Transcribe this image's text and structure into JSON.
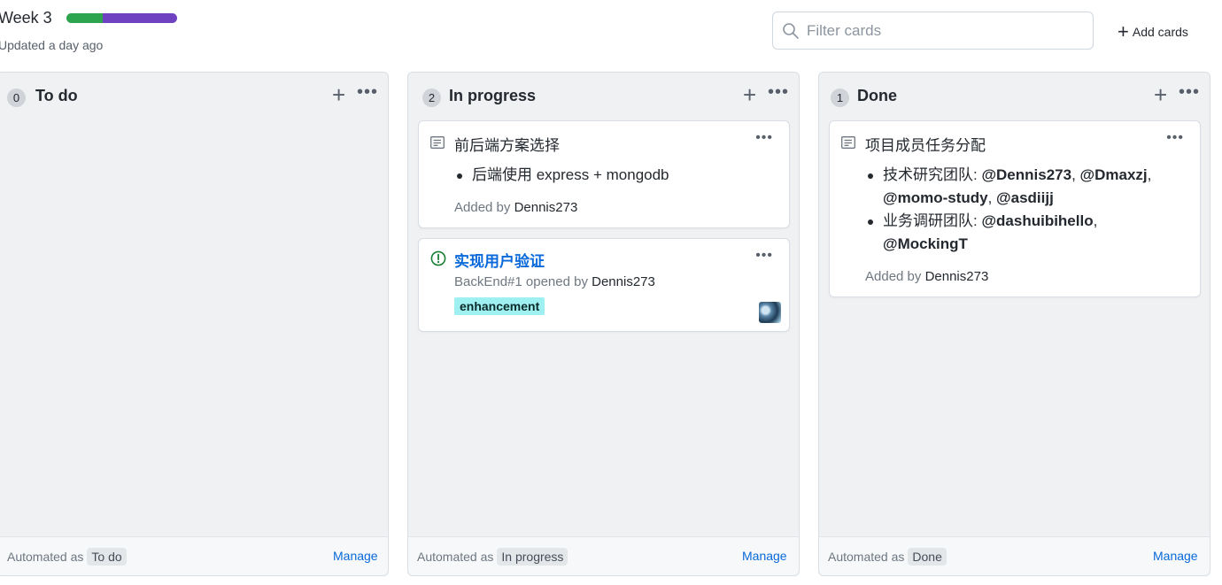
{
  "header": {
    "title": "Week 3",
    "updated": "Updated a day ago",
    "progress": [
      {
        "fraction": 0.33,
        "color": "#2da44e"
      },
      {
        "fraction": 0.67,
        "color": "#6f42c1"
      }
    ],
    "filter_placeholder": "Filter cards",
    "add_cards_label": "Add cards"
  },
  "columns": [
    {
      "count": "0",
      "name": "To do",
      "automated_prefix": "Automated as",
      "automated_tag": "To do",
      "manage_label": "Manage"
    },
    {
      "count": "2",
      "name": "In progress",
      "automated_prefix": "Automated as",
      "automated_tag": "In progress",
      "manage_label": "Manage",
      "cards": [
        {
          "type": "note",
          "title": "前后端方案选择",
          "items": [
            "后端使用 express + mongodb"
          ],
          "added_prefix": "Added by",
          "added_by": "Dennis273"
        },
        {
          "type": "issue",
          "title": "实现用户验证",
          "meta_prefix": "BackEnd#1 opened by",
          "meta_user": "Dennis273",
          "label": "enhancement"
        }
      ]
    },
    {
      "count": "1",
      "name": "Done",
      "automated_prefix": "Automated as",
      "automated_tag": "Done",
      "manage_label": "Manage",
      "cards": [
        {
          "type": "note",
          "title": "项目成员任务分配",
          "items": [
            {
              "prefix": "技术研究团队: ",
              "mentions": [
                "@Dennis273",
                "@Dmaxzj",
                "@momo-study",
                "@asdiijj"
              ]
            },
            {
              "prefix": "业务调研团队: ",
              "mentions": [
                "@dashuibihello",
                "@MockingT"
              ]
            }
          ],
          "added_prefix": "Added by",
          "added_by": "Dennis273"
        }
      ]
    }
  ],
  "icons": {
    "search": "search-icon",
    "plus": "plus-icon",
    "more": "kebab-horizontal-icon",
    "note": "note-icon",
    "issue": "issue-opened-icon",
    "avatar": "user-avatar"
  }
}
